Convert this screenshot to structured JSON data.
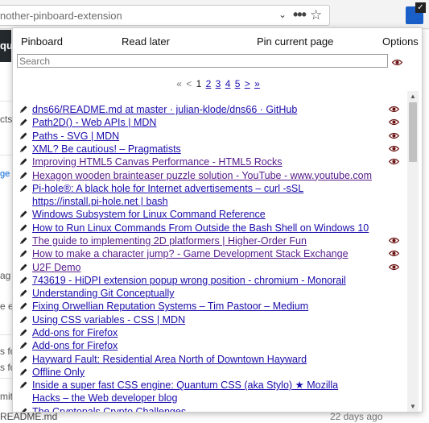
{
  "browser": {
    "url_text": "nother-pinboard-extension",
    "url_chevron": "⌄",
    "more_glyph": "•••",
    "star_glyph": "☆",
    "ext_badge_glyph": "✓"
  },
  "background": {
    "header_fragment": "qu",
    "left_fragments": [
      "cts",
      "ge t",
      "ag",
      "e e",
      "s fo",
      "s fo",
      "mit"
    ],
    "bottom_file": "README.md",
    "bottom_ago": "22 days ago"
  },
  "popup": {
    "nav": {
      "pinboard": "Pinboard",
      "read_later": "Read later",
      "pin_current": "Pin current page",
      "options": "Options"
    },
    "search": {
      "placeholder": "Search",
      "value": ""
    },
    "pager": {
      "first": "«",
      "prev": "<",
      "current": "1",
      "pages": [
        "2",
        "3",
        "4",
        "5"
      ],
      "next": ">",
      "last": "»"
    },
    "items": [
      {
        "title": "dns66/README.md at master · julian-klode/dns66 · GitHub",
        "toread": true,
        "visited": false
      },
      {
        "title": "Path2D() - Web APIs | MDN",
        "toread": true,
        "visited": false
      },
      {
        "title": "Paths - SVG | MDN",
        "toread": true,
        "visited": false
      },
      {
        "title": "XML? Be cautious! – Pragmatists",
        "toread": true,
        "visited": false
      },
      {
        "title": "Improving HTML5 Canvas Performance - HTML5 Rocks",
        "toread": true,
        "visited": true
      },
      {
        "title": "Hexagon wooden brainteaser puzzle solution - YouTube - www.youtube.com",
        "toread": false,
        "visited": true
      },
      {
        "title": "Pi-hole®: A black hole for Internet advertisements – curl -sSL https://install.pi-hole.net | bash",
        "toread": false,
        "visited": false,
        "wrap": true
      },
      {
        "title": "Windows Subsystem for Linux Command Reference",
        "toread": false,
        "visited": false
      },
      {
        "title": "How to Run Linux Commands From Outside the Bash Shell on Windows 10",
        "toread": false,
        "visited": false
      },
      {
        "title": "The guide to implementing 2D platformers | Higher-Order Fun",
        "toread": true,
        "visited": true
      },
      {
        "title": "How to make a character jump? - Game Development Stack Exchange",
        "toread": true,
        "visited": true
      },
      {
        "title": "U2F Demo",
        "toread": true,
        "visited": true
      },
      {
        "title": "743619 - HiDPI extension popup wrong position - chromium - Monorail",
        "toread": false,
        "visited": false
      },
      {
        "title": "Understanding Git Conceptually",
        "toread": false,
        "visited": false
      },
      {
        "title": "Fixing Orwellian Reputation Systems – Tim Pastoor – Medium",
        "toread": false,
        "visited": false
      },
      {
        "title": "Using CSS variables - CSS | MDN",
        "toread": false,
        "visited": false
      },
      {
        "title": "Add-ons for Firefox",
        "toread": false,
        "visited": false
      },
      {
        "title": "Add-ons for Firefox",
        "toread": false,
        "visited": false
      },
      {
        "title": "Hayward Fault:  Residential Area North of Downtown Hayward",
        "toread": false,
        "visited": false
      },
      {
        "title": "Offline Only",
        "toread": false,
        "visited": false
      },
      {
        "title": "Inside a super fast CSS engine: Quantum CSS (aka Stylo) ★ Mozilla Hacks – the Web developer blog",
        "toread": false,
        "visited": false,
        "wrap": true
      },
      {
        "title": "The Cryptopals Crypto Challenges",
        "toread": false,
        "visited": false
      }
    ],
    "colors": {
      "link": "#1a0dab",
      "visited": "#551a8b",
      "eye": "#6b1010"
    }
  }
}
